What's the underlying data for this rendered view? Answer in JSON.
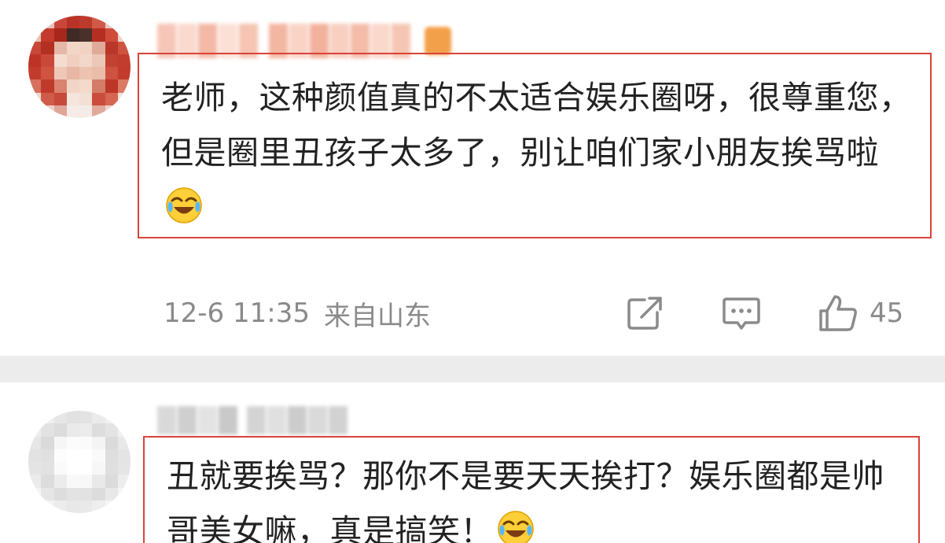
{
  "comments": [
    {
      "text": "老师，这种颜值真的不太适合娱乐圈呀，很尊重您，但是圈里丑孩子太多了，别让咱们家小朋友挨骂啦",
      "emoji": "laughing-crying-emoji",
      "date": "12-6 11:35",
      "location": "来自山东",
      "likes": "45",
      "highlight_color": "#d9443a"
    },
    {
      "text": "丑就要挨骂？那你不是要天天挨打？娱乐圈都是帅哥美女嘛，真是搞笑！",
      "emoji": "laughing-crying-emoji",
      "highlight_color": "#d9443a"
    }
  ],
  "icons": {
    "share": "share-icon",
    "comment": "comment-icon",
    "like": "thumbs-up-icon"
  },
  "colors": {
    "text": "#222222",
    "meta": "#8a8a8a",
    "separator": "#ececec",
    "highlight": "#d9443a"
  }
}
